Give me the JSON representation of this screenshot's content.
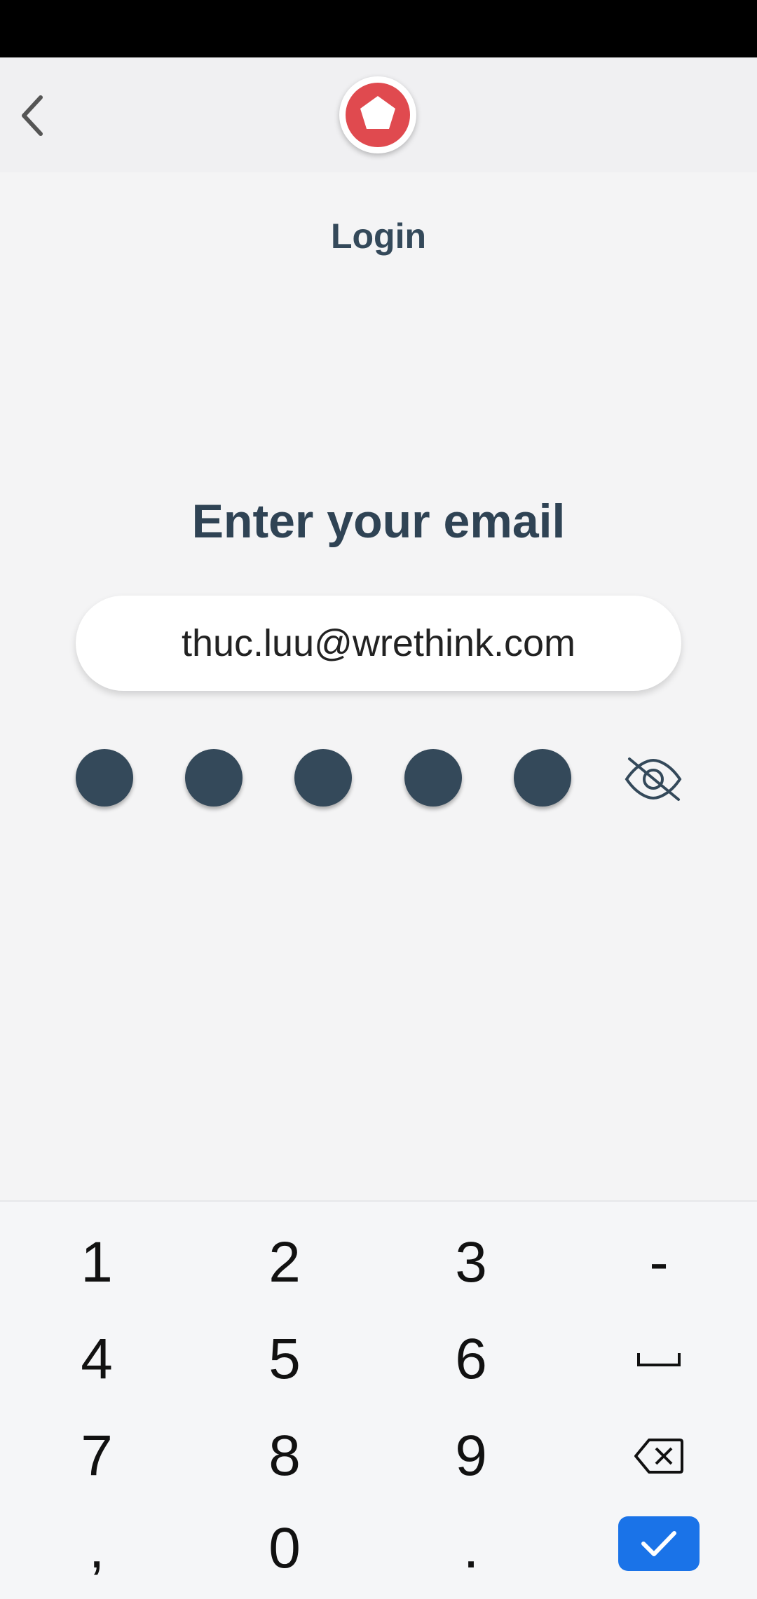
{
  "header": {
    "back_icon": "chevron-left-icon",
    "logo_icon": "pentagon-logo-icon",
    "title": "Login"
  },
  "main": {
    "prompt": "Enter your email",
    "email_value": "thuc.luu@wrethink.com",
    "pin_length": 5,
    "visibility_icon": "eye-off-icon"
  },
  "keyboard": {
    "keys": [
      [
        "1",
        "2",
        "3",
        "-"
      ],
      [
        "4",
        "5",
        "6",
        "space"
      ],
      [
        "7",
        "8",
        "9",
        "backspace"
      ],
      [
        ",",
        "0",
        ".",
        "enter"
      ]
    ]
  },
  "colors": {
    "brand": "#e04a4f",
    "text_dark": "#34495a",
    "accent": "#1a73e8"
  }
}
